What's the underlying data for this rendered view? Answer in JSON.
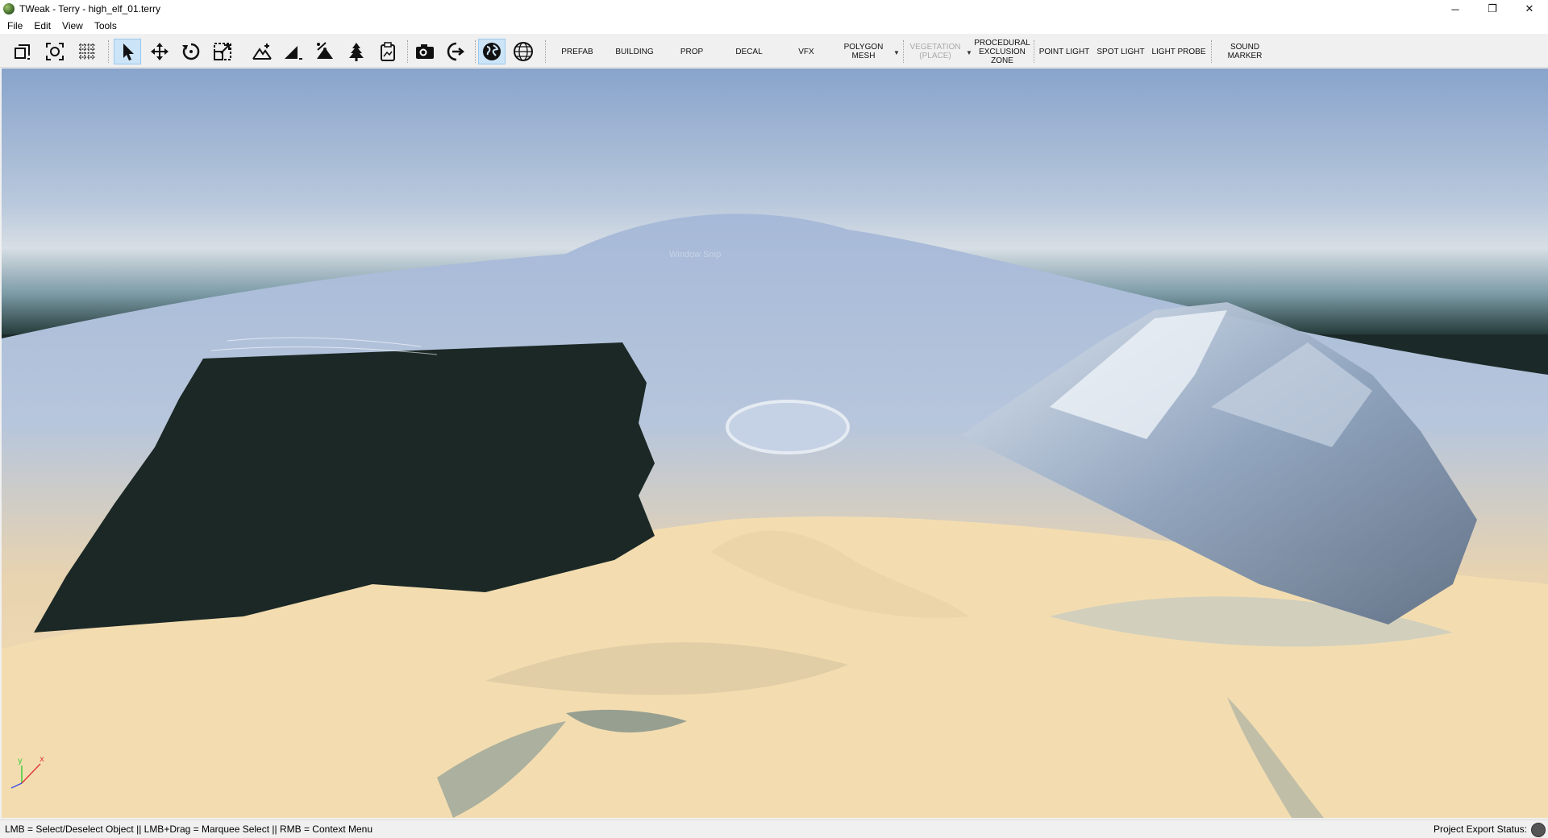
{
  "window": {
    "title": "TWeak - Terry - high_elf_01.terry",
    "minimize": "─",
    "restore": "❐",
    "close": "✕"
  },
  "menu": [
    "File",
    "Edit",
    "View",
    "Tools"
  ],
  "toolbar": {
    "icons": [
      "new-object-icon",
      "zoom-extents-icon",
      "grid-overlay-icon",
      "select-arrow-icon",
      "move-icon",
      "rotate-icon",
      "scale-icon",
      "terrain-raise-icon",
      "terrain-slope-icon",
      "terrain-percent-icon",
      "tree-icon",
      "clipboard-icon",
      "camera-icon",
      "export-arrow-icon",
      "globe-icon",
      "wireframe-sphere-icon"
    ],
    "labels": {
      "prefab": "PREFAB",
      "building": "BUILDING",
      "prop": "PROP",
      "decal": "DECAL",
      "vfx": "VFX",
      "polygon_mesh": "POLYGON MESH",
      "vegetation": "VEGETATION (PLACE)",
      "procedural_exclusion_zone": "PROCEDURAL EXCLUSION ZONE",
      "point_light": "POINT LIGHT",
      "spot_light": "SPOT LIGHT",
      "light_probe": "LIGHT PROBE",
      "sound_marker": "SOUND MARKER"
    }
  },
  "viewport": {
    "overlay_text": "Window Snip",
    "axis_x": "x",
    "axis_y": "y"
  },
  "statusbar": {
    "hint": "LMB = Select/Deselect Object || LMB+Drag = Marquee Select || RMB = Context Menu",
    "export_status_label": "Project Export Status:"
  },
  "colors": {
    "active_tool": "#cce4f7",
    "sky_top": "#8aa6cc",
    "void": "#1b2a28",
    "sand": "#f2dcae"
  }
}
